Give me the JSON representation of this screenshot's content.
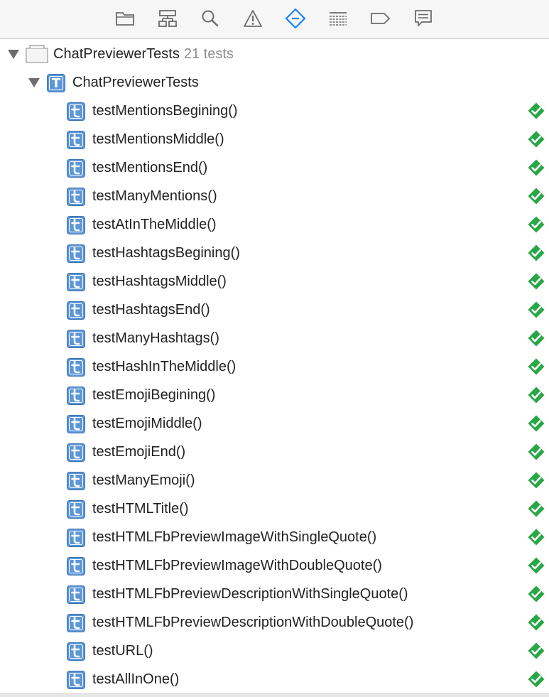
{
  "toolbar": {
    "icons": [
      {
        "name": "folder-icon"
      },
      {
        "name": "hierarchy-icon"
      },
      {
        "name": "search-icon"
      },
      {
        "name": "warning-icon"
      },
      {
        "name": "test-navigator-icon",
        "selected": true
      },
      {
        "name": "debug-icon"
      },
      {
        "name": "breakpoint-icon"
      },
      {
        "name": "report-icon"
      }
    ],
    "accent_color": "#1a82fb"
  },
  "tree": {
    "project": {
      "label": "ChatPreviewerTests",
      "count": "21 tests"
    },
    "target": {
      "label": "ChatPreviewerTests"
    },
    "tests": [
      {
        "label": "testMentionsBegining()",
        "status": "passed"
      },
      {
        "label": "testMentionsMiddle()",
        "status": "passed"
      },
      {
        "label": "testMentionsEnd()",
        "status": "passed"
      },
      {
        "label": "testManyMentions()",
        "status": "passed"
      },
      {
        "label": "testAtInTheMiddle()",
        "status": "passed"
      },
      {
        "label": "testHashtagsBegining()",
        "status": "passed"
      },
      {
        "label": "testHashtagsMiddle()",
        "status": "passed"
      },
      {
        "label": "testHashtagsEnd()",
        "status": "passed"
      },
      {
        "label": "testManyHashtags()",
        "status": "passed"
      },
      {
        "label": "testHashInTheMiddle()",
        "status": "passed"
      },
      {
        "label": "testEmojiBegining()",
        "status": "passed"
      },
      {
        "label": "testEmojiMiddle()",
        "status": "passed"
      },
      {
        "label": "testEmojiEnd()",
        "status": "passed"
      },
      {
        "label": "testManyEmoji()",
        "status": "passed"
      },
      {
        "label": "testHTMLTitle()",
        "status": "passed"
      },
      {
        "label": "testHTMLFbPreviewImageWithSingleQuote()",
        "status": "passed"
      },
      {
        "label": "testHTMLFbPreviewImageWithDoubleQuote()",
        "status": "passed"
      },
      {
        "label": "testHTMLFbPreviewDescriptionWithSingleQuote()",
        "status": "passed"
      },
      {
        "label": "testHTMLFbPreviewDescriptionWithDoubleQuote()",
        "status": "passed"
      },
      {
        "label": "testURL()",
        "status": "passed"
      },
      {
        "label": "testAllInOne()",
        "status": "passed"
      }
    ],
    "passed_color": "#28a745"
  }
}
